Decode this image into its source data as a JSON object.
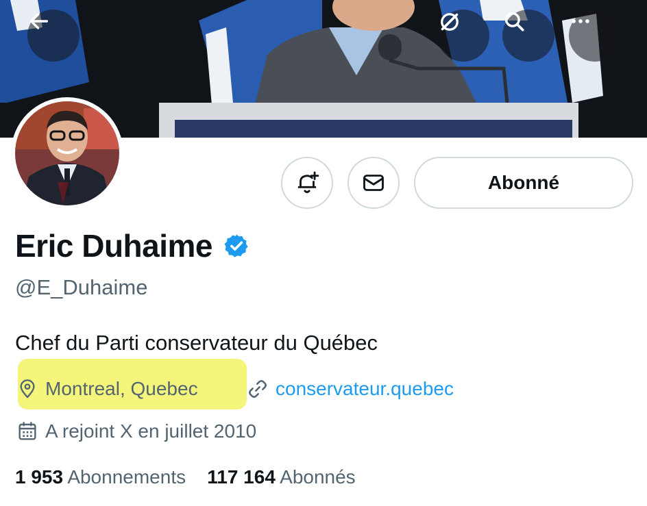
{
  "header": {
    "back_icon": "arrow-left-icon",
    "grok_icon": "slash-circle-icon",
    "search_icon": "search-icon",
    "more_icon": "more-dots-icon"
  },
  "profile": {
    "name": "Eric Duhaime",
    "handle": "@E_Duhaime",
    "bio": "Chef du Parti conservateur du Québec",
    "location": "Montreal, Quebec",
    "website": "conservateur.quebec",
    "joined": "A rejoint X en juillet 2010",
    "following_count": "1 953",
    "following_label": "Abonnements",
    "followers_count": "117 164",
    "followers_label": "Abonnés"
  },
  "actions": {
    "follow_label": "Abonné",
    "notify_icon": "bell-plus-icon",
    "message_icon": "mail-icon"
  },
  "colors": {
    "accent": "#1d9bf0",
    "muted_text": "#536471",
    "highlight": "#f4f57a",
    "verified": "#1d9bf0"
  }
}
